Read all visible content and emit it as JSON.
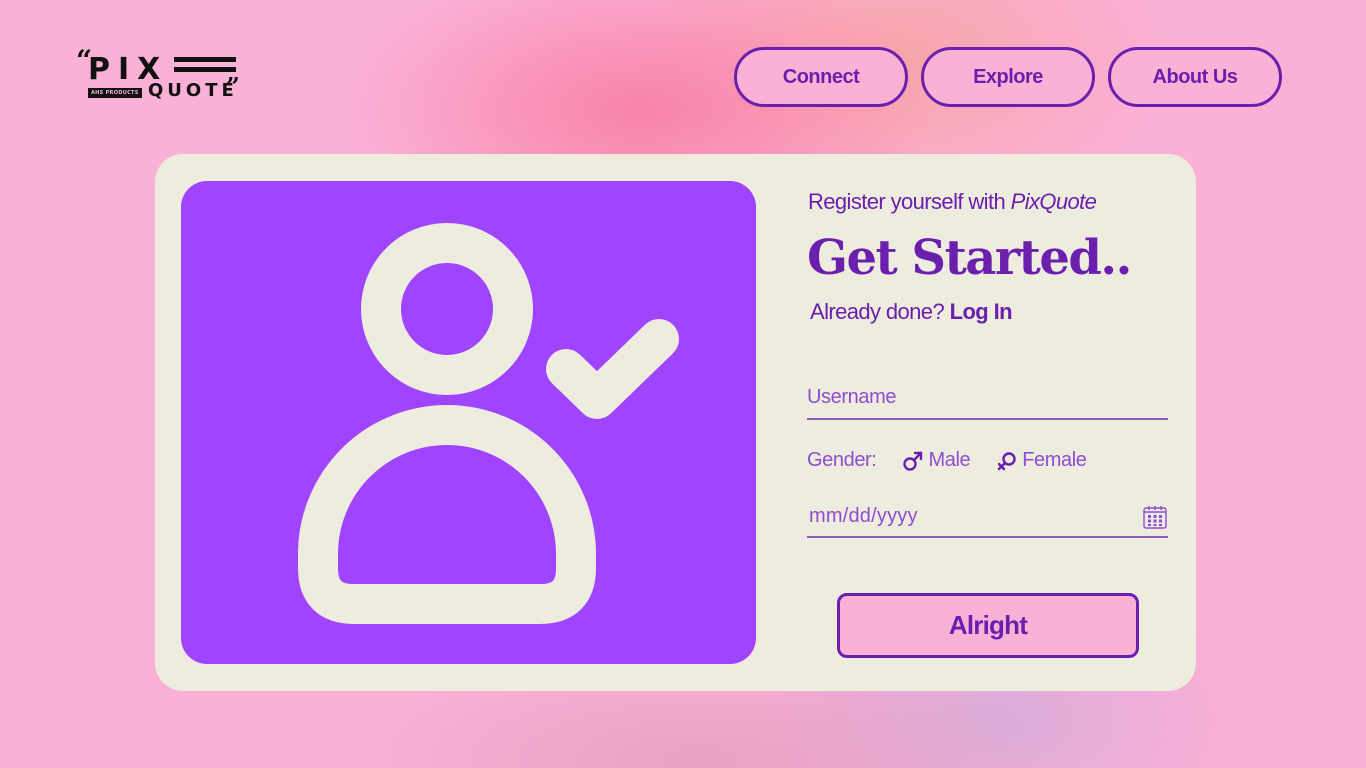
{
  "logo": {
    "word_top": "PIX",
    "word_bottom": "QUOTE",
    "tag": "AHS PRODUCTS"
  },
  "nav": {
    "items": [
      "Connect",
      "Explore",
      "About Us"
    ]
  },
  "form": {
    "tagline_prefix": "Register yourself with ",
    "tagline_brand": "PixQuote",
    "headline": "Get Started..",
    "already_text": "Already done?",
    "login_link": "Log In",
    "username_placeholder": "Username",
    "gender_label": "Gender:",
    "gender_options": [
      "Male",
      "Female"
    ],
    "date_placeholder": "mm/dd/yyyy",
    "submit_label": "Alright"
  },
  "colors": {
    "background": "#fbb0d6",
    "accent": "#6a20ad",
    "illustration_bg": "#9f44ff",
    "card": "#eeebdf"
  },
  "icons": {
    "illustration": "user-check-icon",
    "male": "male-symbol-icon",
    "female": "female-symbol-icon",
    "date": "calendar-icon"
  }
}
